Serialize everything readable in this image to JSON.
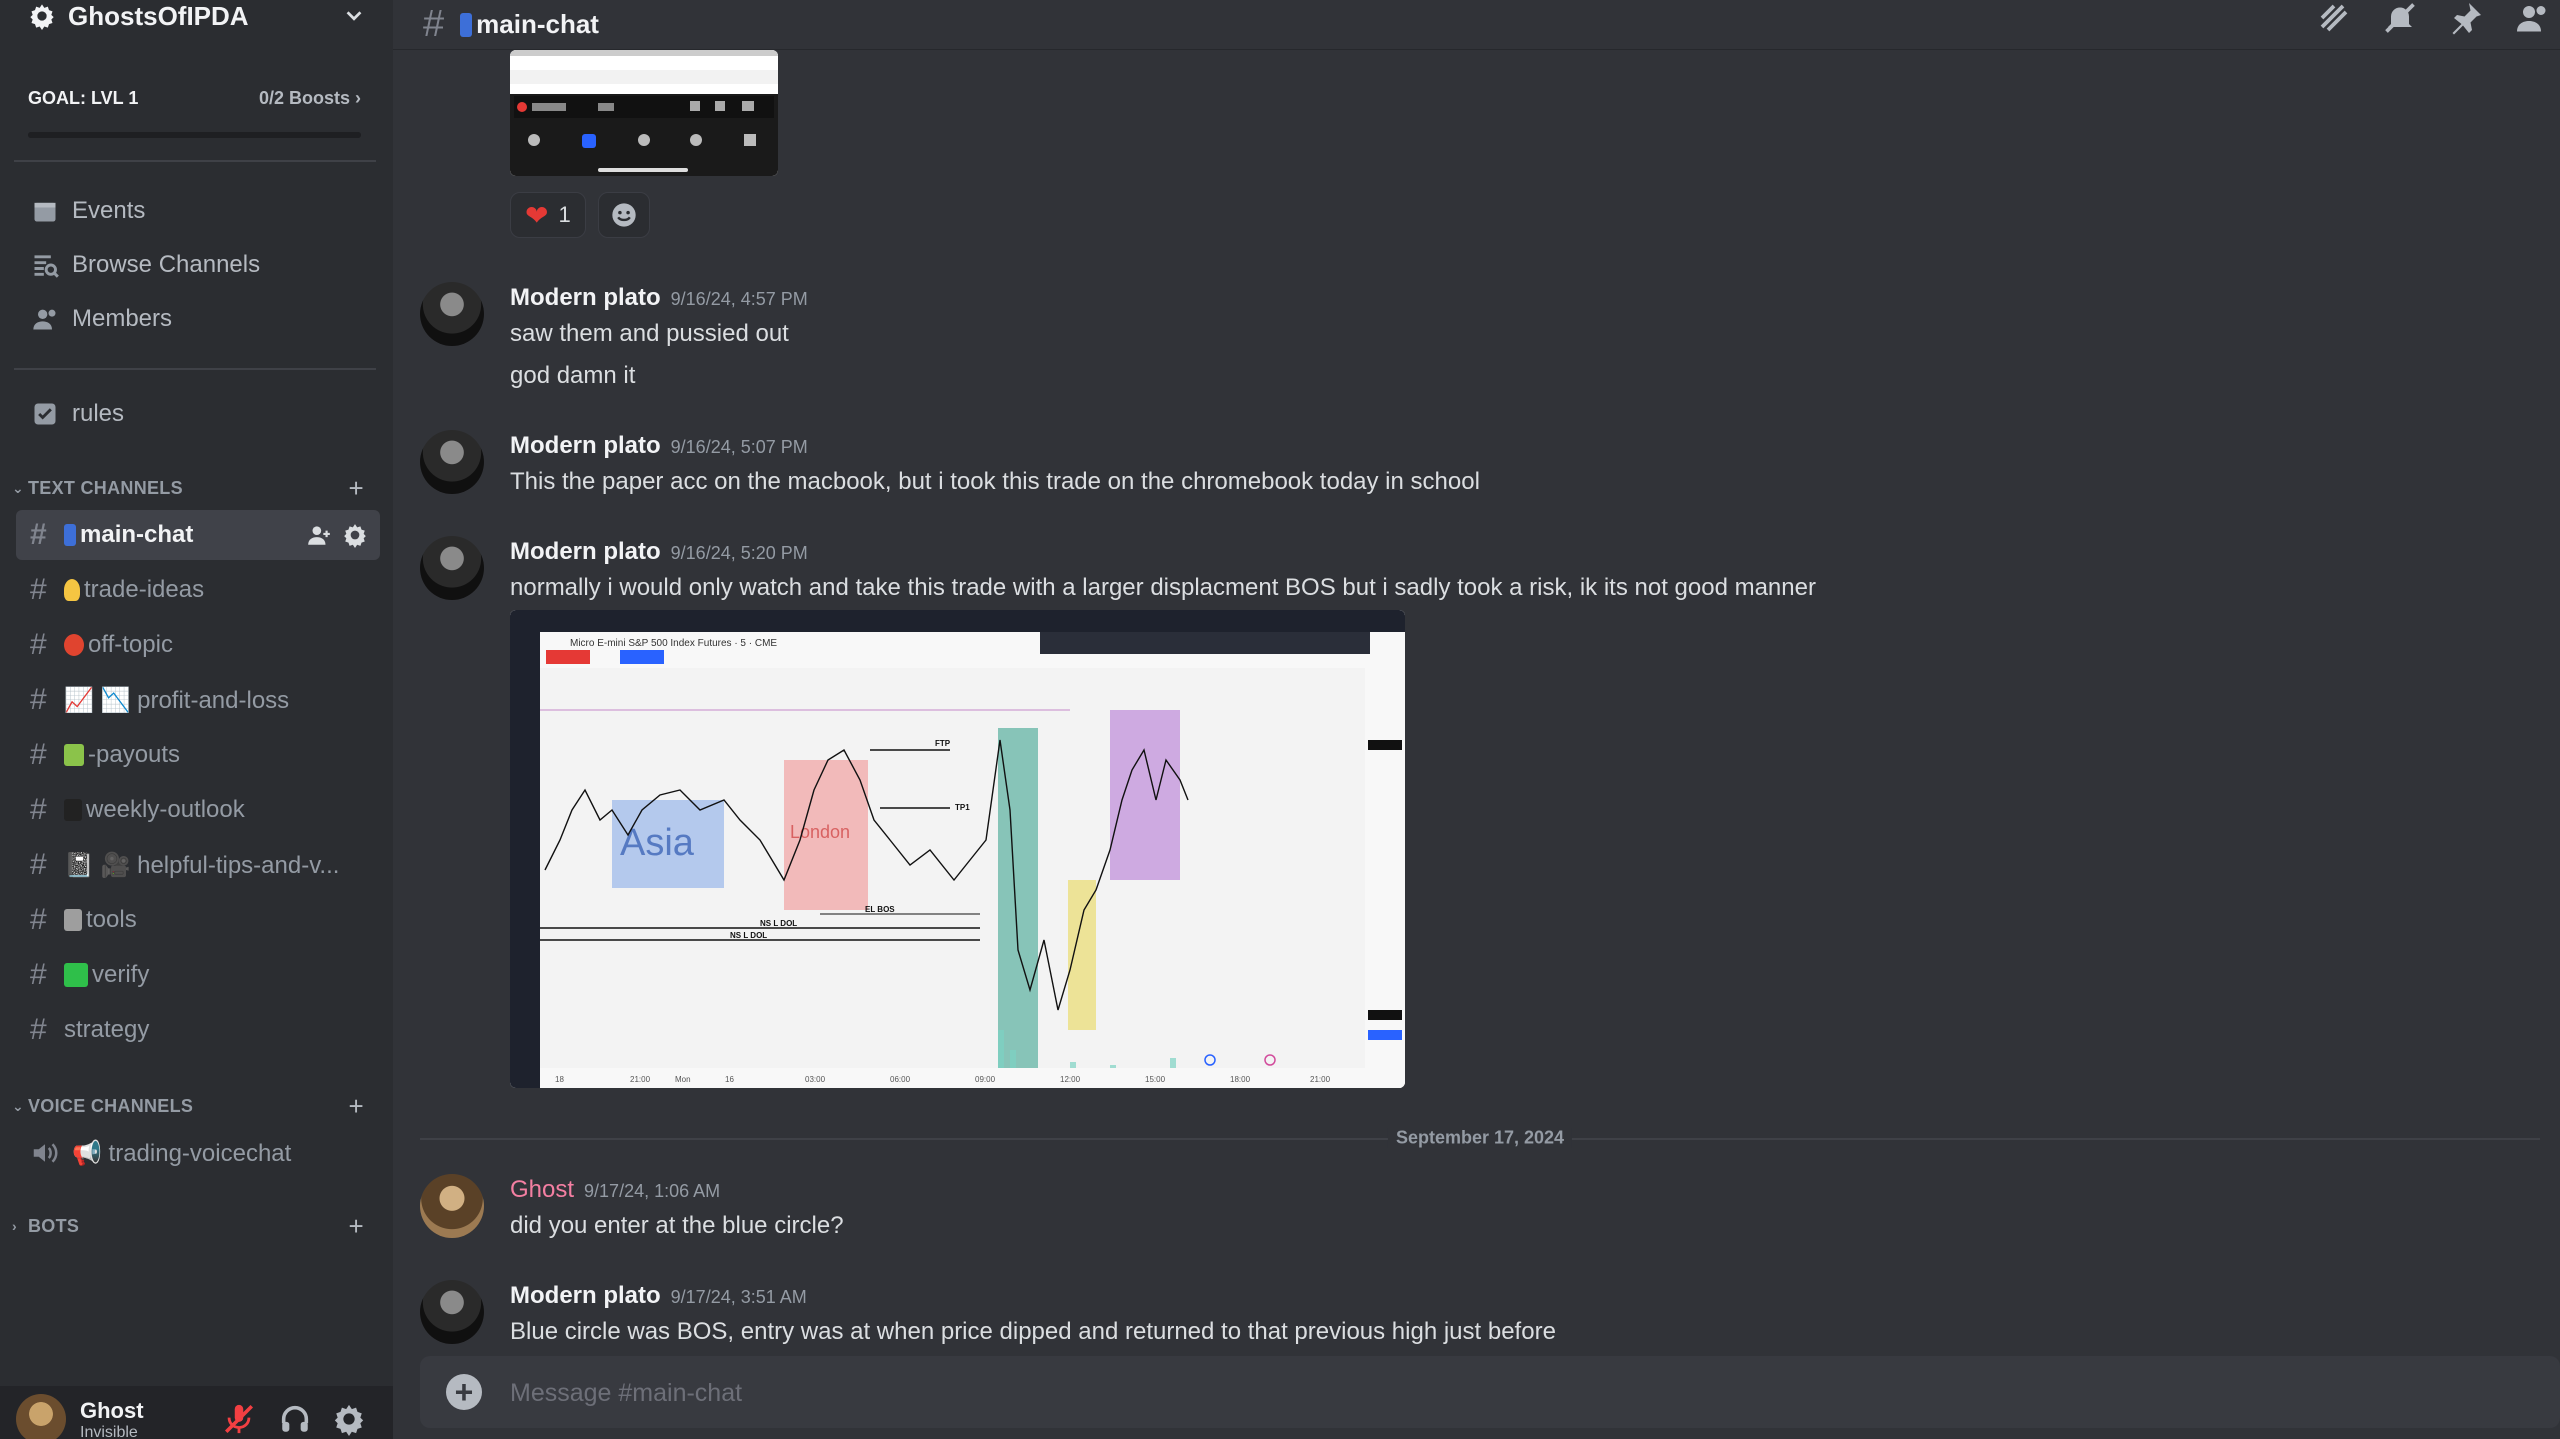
{
  "server": {
    "name": "GhostsOfIPDA"
  },
  "goal": {
    "label": "GOAL: LVL 1",
    "boosts": "0/2 Boosts",
    "progress": 0
  },
  "sidebar_nav": [
    {
      "label": "Events",
      "icon": "calendar-icon"
    },
    {
      "label": "Browse Channels",
      "icon": "browse-channels-icon"
    },
    {
      "label": "Members",
      "icon": "members-icon"
    }
  ],
  "rules": {
    "label": "rules",
    "icon": "rules-icon"
  },
  "categories": {
    "text": "TEXT CHANNELS",
    "voice": "VOICE CHANNELS",
    "bots": "BOTS"
  },
  "text_channels": [
    {
      "label": "main-chat",
      "emoji_color": "#3d6fd8"
    },
    {
      "label": "trade-ideas",
      "emoji_color": "#f5c542"
    },
    {
      "label": "off-topic",
      "emoji_color": "#e0442f"
    },
    {
      "label": "📈 📉 profit-and-loss",
      "emoji_color": "#ffffff"
    },
    {
      "label": "-payouts",
      "emoji_color": "#8bc34a"
    },
    {
      "label": "weekly-outlook",
      "emoji_color": "#222222"
    },
    {
      "label": "📓 🎥 helpful-tips-and-v...",
      "emoji_color": "#888888"
    },
    {
      "label": "tools",
      "emoji_color": "#9e9e9e"
    },
    {
      "label": "verify",
      "emoji_color": "#2fbf4a"
    },
    {
      "label": "strategy",
      "emoji_color": ""
    }
  ],
  "voice_channels": [
    {
      "label": "📢 trading-voicechat"
    }
  ],
  "user": {
    "name": "Ghost",
    "status": "Invisible"
  },
  "channel": {
    "title": "main-chat"
  },
  "reactions": [
    {
      "emoji": "❤",
      "count": "1"
    }
  ],
  "messages": [
    {
      "author": "Modern plato",
      "time": "9/16/24, 4:57 PM",
      "lines": [
        "saw them and pussied out",
        "god damn it"
      ]
    },
    {
      "author": "Modern plato",
      "time": "9/16/24, 5:07 PM",
      "lines": [
        "This the paper acc on the macbook, but i took this trade on the chromebook today in school"
      ]
    },
    {
      "author": "Modern plato",
      "time": "9/16/24, 5:20 PM",
      "lines": [
        "normally i would only watch and take this trade with a larger displacment BOS but i sadly took a risk, ik its not good manner"
      ]
    },
    {
      "author": "Ghost",
      "time": "9/17/24, 1:06 AM",
      "lines": [
        "did you enter at the blue circle?"
      ]
    },
    {
      "author": "Modern plato",
      "time": "9/17/24, 3:51 AM",
      "lines": [
        "Blue circle was BOS, entry was at when price dipped and returned to that previous high just before"
      ]
    }
  ],
  "date_separator": "September 17, 2024",
  "composer": {
    "placeholder": "Message #main-chat"
  },
  "chart_image": {
    "symbol_label": "Micro E-mini S&P 500 Index Futures · 5 · CME",
    "session_labels": [
      "Asia",
      "London"
    ],
    "annotations": [
      "FTP",
      "TP1",
      "EL BOS",
      "NS L DOL",
      "NS L DOL"
    ],
    "time_labels": [
      "18",
      "21:00",
      "Mon",
      "16",
      "03:00",
      "06:00",
      "09:00",
      "12:00",
      "15:00",
      "18:00",
      "21:00"
    ]
  }
}
